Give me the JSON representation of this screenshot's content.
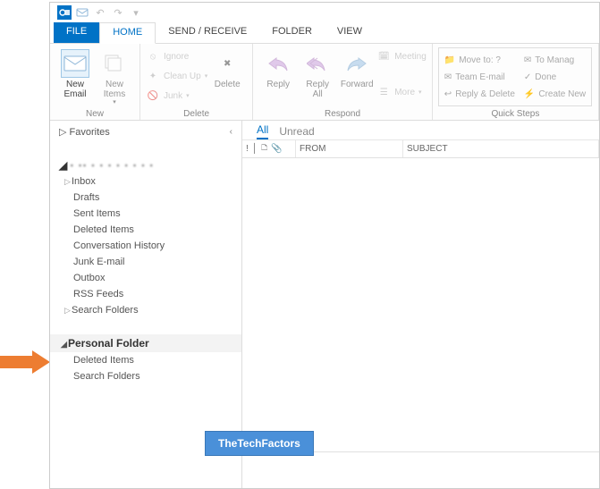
{
  "qat": {
    "undo": "↶",
    "redo": "↷"
  },
  "tabs": {
    "file": "FILE",
    "home": "HOME",
    "sendreceive": "SEND / RECEIVE",
    "folder": "FOLDER",
    "view": "VIEW"
  },
  "ribbon": {
    "new": {
      "label": "New",
      "new_email": "New\nEmail",
      "new_items": "New\nItems"
    },
    "delete": {
      "label": "Delete",
      "ignore": "Ignore",
      "cleanup": "Clean Up",
      "junk": "Junk",
      "delete_btn": "Delete"
    },
    "respond": {
      "label": "Respond",
      "reply": "Reply",
      "reply_all": "Reply\nAll",
      "forward": "Forward",
      "meeting": "Meeting",
      "more": "More"
    },
    "quicksteps": {
      "label": "Quick Steps",
      "moveto": "Move to: ?",
      "tomanager": "To Manag",
      "teamemail": "Team E-mail",
      "done": "Done",
      "replydelete": "Reply & Delete",
      "createnew": "Create New"
    }
  },
  "nav": {
    "favorites": "Favorites",
    "folders": {
      "inbox": "Inbox",
      "drafts": "Drafts",
      "sent": "Sent Items",
      "deleted": "Deleted Items",
      "conv": "Conversation History",
      "junk": "Junk E-mail",
      "outbox": "Outbox",
      "rss": "RSS Feeds",
      "search": "Search Folders"
    },
    "personal": {
      "header": "Personal Folder",
      "deleted": "Deleted Items",
      "search": "Search Folders"
    }
  },
  "list": {
    "all": "All",
    "unread": "Unread",
    "from": "FROM",
    "subject": "SUBJECT"
  },
  "badge": "TheTechFactors"
}
